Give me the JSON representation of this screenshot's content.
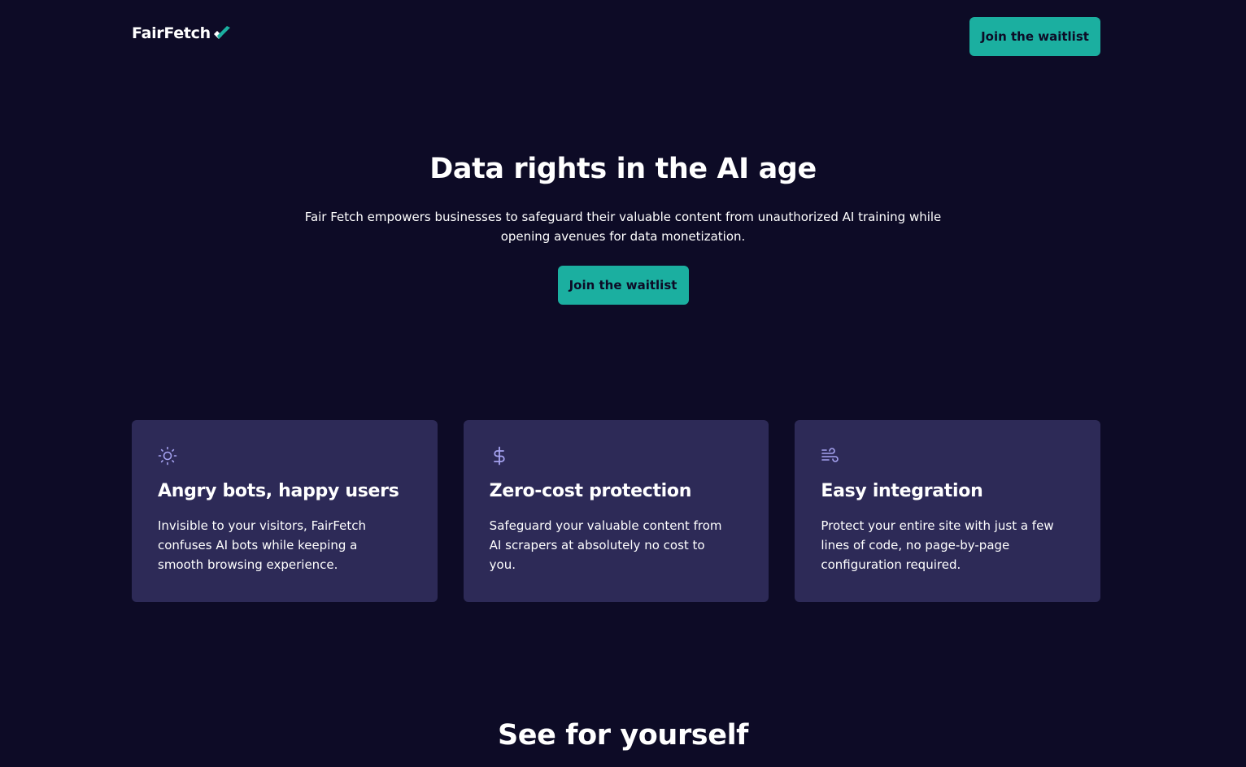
{
  "header": {
    "logo_text": "FairFetch",
    "cta_label": "Join the waitlist"
  },
  "hero": {
    "title": "Data rights in the AI age",
    "subtitle": "Fair Fetch empowers businesses to safeguard their valuable content from unauthorized AI training while opening avenues for data monetization.",
    "cta_label": "Join the waitlist"
  },
  "features": [
    {
      "icon": "sun-icon",
      "title": "Angry bots, happy users",
      "text": "Invisible to your visitors, FairFetch confuses AI bots while keeping a smooth browsing experience."
    },
    {
      "icon": "dollar-icon",
      "title": "Zero-cost protection",
      "text": "Safeguard your valuable content from AI scrapers at absolutely no cost to you."
    },
    {
      "icon": "wind-icon",
      "title": "Easy integration",
      "text": "Protect your entire site with just a few lines of code, no page-by-page configuration required."
    }
  ],
  "section2": {
    "title": "See for yourself"
  },
  "colors": {
    "background": "#0d0b26",
    "accent": "#1bafa0",
    "card": "#2d2a57",
    "icon": "#a5a2f0"
  }
}
